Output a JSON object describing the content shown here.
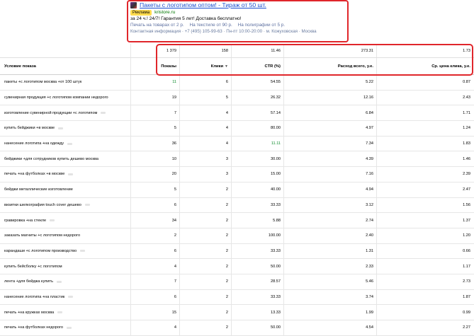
{
  "ad": {
    "title": "Пакеты с логотипом оптом! - Тираж от 50 шт.",
    "badge": "Реклама",
    "domain": "kristore.ru",
    "description": "за 24 ч.! 24/7! Гарантия 5 лет! Доставка бесплатно!",
    "sitelinks": [
      "Печать на товарах от 2 р.",
      "На текстиле от 90 р.",
      "На полиграфии от 5 р."
    ],
    "contact": "Контактная информация · +7 (495) 105-99-63 · Пн-пт 10:00-20:00 · м. Кожуховская · Москва"
  },
  "totals": {
    "search": "",
    "impressions": "1 379",
    "clicks": "158",
    "ctr": "11.46",
    "spend": "273.31",
    "avg_cpc": "1.73"
  },
  "columns": {
    "condition": "Условие показа",
    "impressions": "Показы",
    "clicks": "Клики",
    "ctr": "CTR (%)",
    "spend": "Расход всего, у.е.",
    "avg_cpc": "Ср. цена клика, у.е."
  },
  "rows": [
    {
      "condition": "пакеты +с логотипом москва +от 100 штук",
      "impressions": "11",
      "clicks": "6",
      "ctr": "54.55",
      "spend": "5.22",
      "cpc": "0.87",
      "mini": false,
      "imp_green": true,
      "ctr_green": false
    },
    {
      "condition": "сувенирная продукция +с логотипом компании недорого",
      "impressions": "19",
      "clicks": "5",
      "ctr": "26.32",
      "spend": "12.16",
      "cpc": "2.43",
      "mini": false,
      "imp_green": false,
      "ctr_green": false
    },
    {
      "condition": "изготовление сувенирной продукции +с логотипом",
      "impressions": "7",
      "clicks": "4",
      "ctr": "57.14",
      "spend": "6.84",
      "cpc": "1.71",
      "mini": true,
      "imp_green": false,
      "ctr_green": false
    },
    {
      "condition": "купить бейджики +в москве",
      "impressions": "5",
      "clicks": "4",
      "ctr": "80.00",
      "spend": "4.97",
      "cpc": "1.24",
      "mini": true,
      "imp_green": false,
      "ctr_green": false
    },
    {
      "condition": "нанесение логотипа +на одежду",
      "impressions": "36",
      "clicks": "4",
      "ctr": "11.11",
      "spend": "7.34",
      "cpc": "1.83",
      "mini": true,
      "imp_green": false,
      "ctr_green": true
    },
    {
      "condition": "бейджики +для сотрудников купить дешево москва",
      "impressions": "10",
      "clicks": "3",
      "ctr": "30.00",
      "spend": "4.39",
      "cpc": "1.46",
      "mini": false,
      "imp_green": false,
      "ctr_green": false
    },
    {
      "condition": "печать +на футболках +в москве",
      "impressions": "20",
      "clicks": "3",
      "ctr": "15.00",
      "spend": "7.16",
      "cpc": "2.39",
      "mini": true,
      "imp_green": false,
      "ctr_green": false
    },
    {
      "condition": "бейджи металлические изготовление",
      "impressions": "5",
      "clicks": "2",
      "ctr": "40.00",
      "spend": "4.94",
      "cpc": "2.47",
      "mini": false,
      "imp_green": false,
      "ctr_green": false
    },
    {
      "condition": "визитки шелкография touch cover дешево",
      "impressions": "6",
      "clicks": "2",
      "ctr": "33.33",
      "spend": "3.12",
      "cpc": "1.56",
      "mini": true,
      "imp_green": false,
      "ctr_green": false
    },
    {
      "condition": "гравировка +на стекле",
      "impressions": "34",
      "clicks": "2",
      "ctr": "5.88",
      "spend": "2.74",
      "cpc": "1.37",
      "mini": true,
      "imp_green": false,
      "ctr_green": false
    },
    {
      "condition": "заказать магниты +с логотипом недорого",
      "impressions": "2",
      "clicks": "2",
      "ctr": "100.00",
      "spend": "2.40",
      "cpc": "1.20",
      "mini": false,
      "imp_green": false,
      "ctr_green": false
    },
    {
      "condition": "карандаши +с логотипом производство",
      "impressions": "6",
      "clicks": "2",
      "ctr": "33.33",
      "spend": "1.31",
      "cpc": "0.66",
      "mini": true,
      "imp_green": false,
      "ctr_green": false
    },
    {
      "condition": "купить бейсболку +с логотипом",
      "impressions": "4",
      "clicks": "2",
      "ctr": "50.00",
      "spend": "2.33",
      "cpc": "1.17",
      "mini": false,
      "imp_green": false,
      "ctr_green": false
    },
    {
      "condition": "лента +для бейджа купить",
      "impressions": "7",
      "clicks": "2",
      "ctr": "28.57",
      "spend": "5.46",
      "cpc": "2.73",
      "mini": true,
      "imp_green": false,
      "ctr_green": false
    },
    {
      "condition": "нанесение логотипа +на пластик",
      "impressions": "6",
      "clicks": "2",
      "ctr": "33.33",
      "spend": "3.74",
      "cpc": "1.87",
      "mini": true,
      "imp_green": false,
      "ctr_green": false
    },
    {
      "condition": "печать +на кружках москва",
      "impressions": "15",
      "clicks": "2",
      "ctr": "13.33",
      "spend": "1.99",
      "cpc": "0.99",
      "mini": true,
      "imp_green": false,
      "ctr_green": false
    },
    {
      "condition": "печать +на футболках недорого",
      "impressions": "4",
      "clicks": "2",
      "ctr": "50.00",
      "spend": "4.54",
      "cpc": "2.27",
      "mini": true,
      "imp_green": false,
      "ctr_green": false
    }
  ]
}
